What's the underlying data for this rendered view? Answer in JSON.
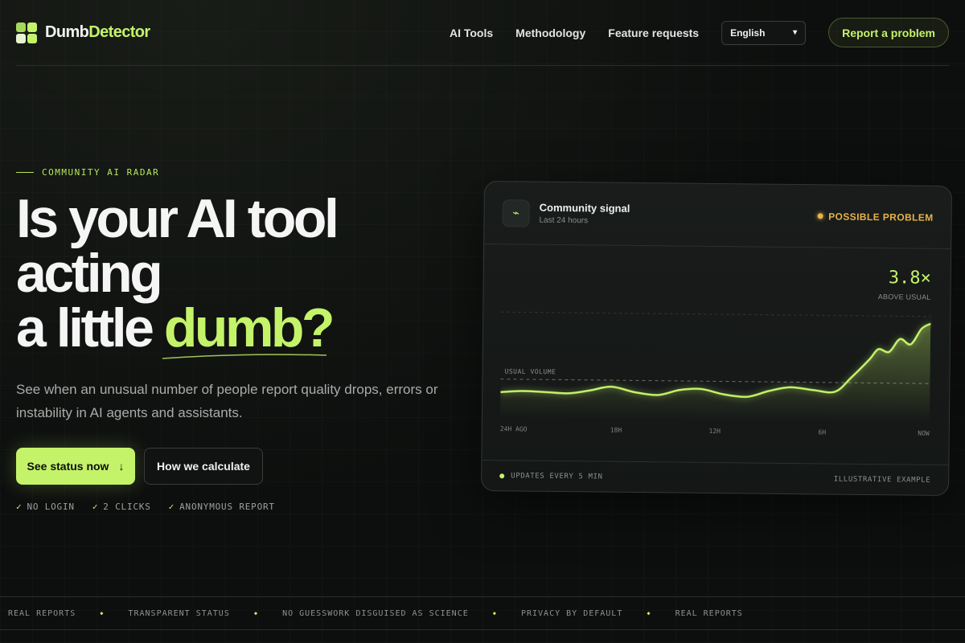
{
  "header": {
    "logo_part1": "Dumb",
    "logo_part2": "Detector",
    "nav": [
      "AI Tools",
      "Methodology",
      "Feature requests"
    ],
    "language": "English",
    "report_button": "Report a problem"
  },
  "hero": {
    "eyebrow": "COMMUNITY AI RADAR",
    "title_line1": "Is your AI tool",
    "title_line2": "acting",
    "title_line3_pre": "a little ",
    "title_line3_accent": "dumb?",
    "subtitle": "See when an unusual number of people report quality drops, errors or instability in AI agents and assistants.",
    "cta_primary": "See status now",
    "cta_primary_arrow": "↓",
    "cta_secondary": "How we calculate",
    "checks": [
      "NO LOGIN",
      "2 CLICKS",
      "ANONYMOUS REPORT"
    ],
    "check_mark": "✓"
  },
  "card": {
    "icon": "⌁",
    "title": "Community signal",
    "subtitle": "Last 24 hours",
    "status": "POSSIBLE PROBLEM",
    "metric_value": "3.8×",
    "metric_label": "ABOVE USUAL",
    "footer_left": "UPDATES EVERY 5 MIN",
    "footer_right": "ILLUSTRATIVE EXAMPLE"
  },
  "chart_data": {
    "type": "area",
    "baseline_label": "USUAL VOLUME",
    "x_ticks": [
      "24H AGO",
      "18H",
      "12H",
      "6H",
      "NOW"
    ],
    "x": [
      24,
      22.8,
      21.5,
      20.2,
      19,
      17.8,
      16.5,
      15.2,
      14,
      12.8,
      11.5,
      10.2,
      9,
      7.8,
      6.5,
      5.3,
      4.4,
      3.4,
      2.9,
      2.3,
      1.7,
      1.1,
      0.5,
      0
    ],
    "values": [
      1.0,
      1.05,
      1.02,
      0.98,
      1.1,
      1.25,
      1.05,
      0.95,
      1.15,
      1.2,
      1.0,
      0.92,
      1.15,
      1.3,
      1.2,
      1.15,
      1.7,
      2.4,
      2.8,
      2.7,
      3.2,
      3.0,
      3.6,
      3.8
    ],
    "baseline_value": 1.5,
    "ylim": [
      0,
      4.2
    ],
    "colors": {
      "line": "#c4f36a",
      "status": "#e8b24a"
    },
    "grid": true
  },
  "ticker": [
    "REAL REPORTS",
    "TRANSPARENT STATUS",
    "NO GUESSWORK DISGUISED AS SCIENCE",
    "PRIVACY BY DEFAULT",
    "REAL REPORTS"
  ],
  "ticker_sep": "◆"
}
